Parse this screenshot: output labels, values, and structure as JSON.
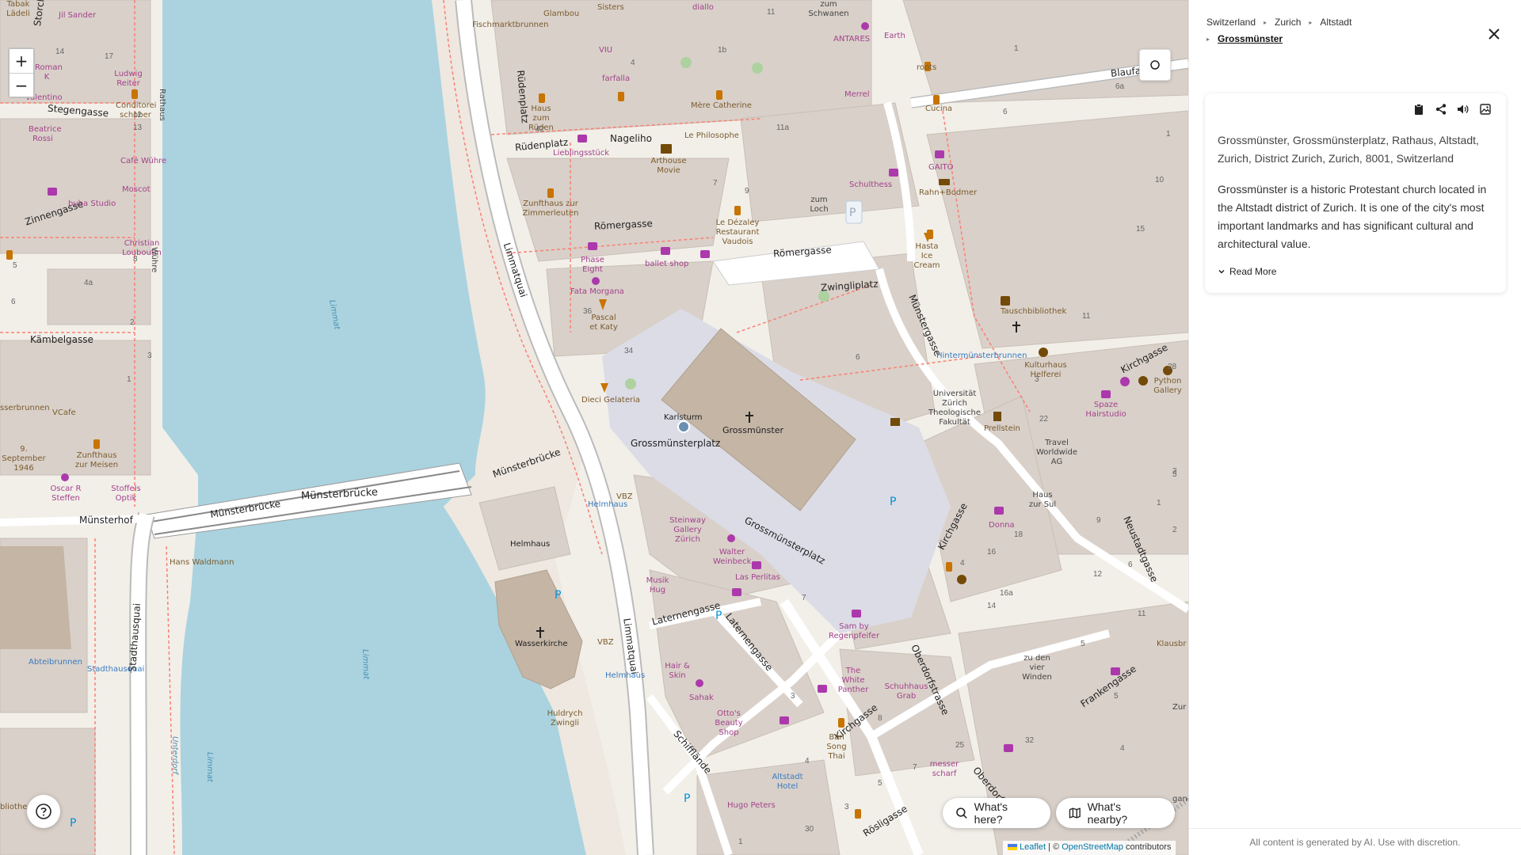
{
  "map": {
    "zoom_in": "+",
    "zoom_out": "−",
    "streets": [
      {
        "id": "ruedenplatz-1",
        "text": "Rüdenplatz"
      },
      {
        "id": "ruedenplatz-2",
        "text": "Rüdenplatz"
      },
      {
        "id": "nageliho",
        "text": "Nageliho"
      },
      {
        "id": "roemergasse-1",
        "text": "Römergasse"
      },
      {
        "id": "roemergasse-2",
        "text": "Römergasse"
      },
      {
        "id": "zwingliplatz",
        "text": "Zwingliplatz"
      },
      {
        "id": "limmatquai-1",
        "text": "Limmatquai"
      },
      {
        "id": "limmatquai-2",
        "text": "Limmatquai"
      },
      {
        "id": "muensterbruecke-1",
        "text": "Münsterbrücke"
      },
      {
        "id": "muensterbruecke-2",
        "text": "Münsterbrücke"
      },
      {
        "id": "muensterbruecke-3",
        "text": "Münsterbrücke"
      },
      {
        "id": "muensterhof",
        "text": "Münsterhof"
      },
      {
        "id": "grossmuensterplatz-1",
        "text": "Grossmünsterplatz"
      },
      {
        "id": "grossmuensterplatz-2",
        "text": "Grossmünsterplatz"
      },
      {
        "id": "stegengasse",
        "text": "Stegengasse"
      },
      {
        "id": "zinnengasse",
        "text": "Zinnengasse"
      },
      {
        "id": "kaembelgasse",
        "text": "Kämbelgasse"
      },
      {
        "id": "laternengasse-1",
        "text": "Laternengasse"
      },
      {
        "id": "laternengasse-2",
        "text": "Laternengasse"
      },
      {
        "id": "kirchgasse-1",
        "text": "Kirchgasse"
      },
      {
        "id": "kirchgasse-2",
        "text": "Kirchgasse"
      },
      {
        "id": "kirchgasse-3",
        "text": "Kirchgasse"
      },
      {
        "id": "muenstergasse",
        "text": "Münstergasse"
      },
      {
        "id": "neustadtgasse",
        "text": "Neustadtgasse"
      },
      {
        "id": "oberdorfstrasse-1",
        "text": "Oberdorfstrasse"
      },
      {
        "id": "oberdorfstrasse-2",
        "text": "Oberdorfstr"
      },
      {
        "id": "frankengasse",
        "text": "Frankengasse"
      },
      {
        "id": "roesligasse",
        "text": "Rösligasse"
      },
      {
        "id": "schifflaende",
        "text": "Schifflände"
      },
      {
        "id": "stadthausquai",
        "text": "Stadthausquai"
      },
      {
        "id": "blaufahne",
        "text": "Blaufa"
      },
      {
        "id": "storchengasse",
        "text": "Storche"
      }
    ],
    "pois": [
      {
        "id": "grossmuenster",
        "text": "Grossmünster"
      },
      {
        "id": "wasserkirche",
        "text": "Wasserkirche"
      },
      {
        "id": "helmhaus",
        "text": "Helmhaus"
      },
      {
        "id": "karlsturm",
        "text": "Karlsturm"
      },
      {
        "id": "huldrych-zwingli",
        "text": "Huldrych Zwingli"
      },
      {
        "id": "hans-waldmann",
        "text": "Hans Waldmann"
      },
      {
        "id": "arthouse-movie",
        "text": "Arthouse Movie"
      },
      {
        "id": "schulthess",
        "text": "Schulthess"
      },
      {
        "id": "zum-loch",
        "text": "zum Loch"
      },
      {
        "id": "universitaet",
        "text": "Universität Zürich Theologische Fakultät"
      },
      {
        "id": "tauschbibliothek",
        "text": "Tauschbibliothek"
      },
      {
        "id": "kulturhaus-helferei",
        "text": "Kulturhaus Helferei"
      },
      {
        "id": "hintermuensterbrunnen",
        "text": "Hintermünsterbrunnen"
      },
      {
        "id": "python-gallery",
        "text": "Python Gallery"
      },
      {
        "id": "spaze-hairstudio",
        "text": "Spaze Hairstudio"
      },
      {
        "id": "travel-worldwide",
        "text": "Travel Worldwide AG"
      },
      {
        "id": "haus-zur-sul",
        "text": "Haus zur Sul"
      },
      {
        "id": "prellstein",
        "text": "Prellstein"
      },
      {
        "id": "donna",
        "text": "Donna"
      },
      {
        "id": "steinway",
        "text": "Steinway Gallery Zürich"
      },
      {
        "id": "walter-weinbeck",
        "text": "Walter Weinbeck"
      },
      {
        "id": "las-perlitas",
        "text": "Las Perlitas"
      },
      {
        "id": "musik-hug",
        "text": "Musik Hug"
      },
      {
        "id": "sam-by-regenpfeifer",
        "text": "Sam by Regenpfeifer"
      },
      {
        "id": "white-panther",
        "text": "The White Panther"
      },
      {
        "id": "schuhhaus-grab",
        "text": "Schuhhaus Grab"
      },
      {
        "id": "zu-den-vier-winden",
        "text": "zu den vier Winden"
      },
      {
        "id": "hair-skin",
        "text": "Hair & Skin"
      },
      {
        "id": "sahak",
        "text": "Sahak"
      },
      {
        "id": "ottos-beauty",
        "text": "Otto's Beauty Shop"
      },
      {
        "id": "ban-song-thai",
        "text": "Ban Song Thai"
      },
      {
        "id": "altstadt-hotel",
        "text": "Altstadt Hotel"
      },
      {
        "id": "hugo-peters",
        "text": "Hugo Peters"
      },
      {
        "id": "messer-scharf",
        "text": "messer scharf"
      },
      {
        "id": "dieci-gelateria",
        "text": "Dieci Gelateria"
      },
      {
        "id": "pascal-katy",
        "text": "Pascal et Katy"
      },
      {
        "id": "fata-morgana",
        "text": "Fata Morgana"
      },
      {
        "id": "phase-eight",
        "text": "Phase Eight"
      },
      {
        "id": "ballet-shop",
        "text": "ballet shop"
      },
      {
        "id": "le-dezaley",
        "text": "Le Dézaley Restaurant Vaudois"
      },
      {
        "id": "zunfthaus-zimmerleuten",
        "text": "Zunfthaus zur Zimmerleuten"
      },
      {
        "id": "lieblingsstueck",
        "text": "Lieblingsstück"
      },
      {
        "id": "haus-zum-rueden",
        "text": "Haus zum Rüden"
      },
      {
        "id": "mere-catherine",
        "text": "Mère Catherine"
      },
      {
        "id": "le-philosophe",
        "text": "Le Philosophe"
      },
      {
        "id": "farfalla",
        "text": "farfalla"
      },
      {
        "id": "viu",
        "text": "VIU"
      },
      {
        "id": "fischmarktbrunnen",
        "text": "Fischmarktbrunnen"
      },
      {
        "id": "glambou",
        "text": "Glambou"
      },
      {
        "id": "sisters",
        "text": "Sisters"
      },
      {
        "id": "diallo",
        "text": "diallo"
      },
      {
        "id": "zum-schwanen",
        "text": "zum Schwanen"
      },
      {
        "id": "antares",
        "text": "ANTARES"
      },
      {
        "id": "earth",
        "text": "Earth"
      },
      {
        "id": "roots",
        "text": "roots"
      },
      {
        "id": "merrel",
        "text": "Merrel"
      },
      {
        "id": "cucina",
        "text": "Cucina"
      },
      {
        "id": "gaito",
        "text": "GAITO"
      },
      {
        "id": "rahn-bodmer",
        "text": "Rahn+Bodmer"
      },
      {
        "id": "hasta-ice-cream",
        "text": "Hasta Ice Cream"
      },
      {
        "id": "vbz-1",
        "text": "VBZ"
      },
      {
        "id": "vbz-2",
        "text": "VBZ"
      },
      {
        "id": "helmhaus-stop-1",
        "text": "Helmhaus"
      },
      {
        "id": "helmhaus-stop-2",
        "text": "Helmhaus"
      },
      {
        "id": "stadthausquai-stop",
        "text": "Stadthausquai"
      },
      {
        "id": "abteibrunnen",
        "text": "Abteibrunnen"
      },
      {
        "id": "zunfthaus-meisen",
        "text": "Zunfthaus zur Meisen"
      },
      {
        "id": "oscar-r-steffen",
        "text": "Oscar R Steffen"
      },
      {
        "id": "stoffels-optik",
        "text": "Stoffels Optik"
      },
      {
        "id": "9-september",
        "text": "9. September 1946"
      },
      {
        "id": "ssenbrunnen",
        "text": "sserbrunnen"
      },
      {
        "id": "vcafe",
        "text": "VCafe"
      },
      {
        "id": "buba-studio",
        "text": "buba Studio"
      },
      {
        "id": "christian-louboutin",
        "text": "Christian Louboutin"
      },
      {
        "id": "cafe-wuhre",
        "text": "Café Wühre"
      },
      {
        "id": "moscot",
        "text": "Moscot"
      },
      {
        "id": "beatrice-rossi",
        "text": "Beatrice Rossi"
      },
      {
        "id": "valentino",
        "text": "Valentino"
      },
      {
        "id": "conditorei-schober",
        "text": "Conditorei schober"
      },
      {
        "id": "ludwig-reiter",
        "text": "Ludwig Reiter"
      },
      {
        "id": "roman-k",
        "text": "Roman K"
      },
      {
        "id": "jil-sander",
        "text": "Jil Sander"
      },
      {
        "id": "tabak-laedeli",
        "text": "Tabak Lädeli"
      },
      {
        "id": "klausbr",
        "text": "Klausbr"
      },
      {
        "id": "zur",
        "text": "Zur"
      },
      {
        "id": "bliothe",
        "text": "bliothe"
      },
      {
        "id": "wuhre",
        "text": "Wühre"
      },
      {
        "id": "rathaus-label",
        "text": "Rathaus"
      },
      {
        "id": "limmat-1",
        "text": "Limmat"
      },
      {
        "id": "limmat-2",
        "text": "Limmat"
      },
      {
        "id": "limmat-3",
        "text": "Limmat"
      },
      {
        "id": "unterdorf",
        "text": "Unterdorf"
      },
      {
        "id": "gande",
        "text": "gande"
      }
    ],
    "house_numbers": [
      "14",
      "17",
      "12",
      "13",
      "8",
      "4a",
      "2",
      "6",
      "3",
      "5",
      "1",
      "42",
      "11",
      "4",
      "9",
      "1b",
      "11a",
      "7",
      "36",
      "34",
      "6",
      "28",
      "11",
      "22",
      "1",
      "3",
      "5",
      "9",
      "18",
      "16",
      "16a",
      "14",
      "12",
      "5",
      "6",
      "7",
      "4",
      "3",
      "8",
      "25",
      "32",
      "4",
      "5",
      "7",
      "3",
      "30",
      "1",
      "2",
      "4",
      "3",
      "10",
      "15",
      "6a",
      "6",
      "1",
      "3",
      "5",
      "2",
      "11",
      "6",
      "1"
    ],
    "help_icon": "question-icon",
    "whats_here": "What's here?",
    "whats_nearby": "What's nearby?",
    "attribution_leaflet": "Leaflet",
    "attribution_sep": " | © ",
    "attribution_osm": "OpenStreetMap",
    "attribution_contrib": " contributors"
  },
  "panel": {
    "breadcrumb": [
      "Switzerland",
      "Zurich",
      "Altstadt",
      "Grossmünster"
    ],
    "address": "Grossmünster, Grossmünsterplatz, Rathaus, Altstadt, Zurich, District Zurich, Zurich, 8001, Switzerland",
    "description": "Grossmünster is a historic Protestant church located in the Altstadt district of Zurich. It is one of the city's most important landmarks and has significant cultural and architectural value.",
    "read_more": "Read More",
    "footer": "All content is generated by AI. Use with discretion.",
    "tools": [
      "clipboard-icon",
      "share-icon",
      "speaker-icon",
      "image-icon"
    ]
  },
  "colors": {
    "water": "#aad3df",
    "building": "#d9d0c9",
    "church": "#c4b5a5",
    "plaza": "#dcdce6",
    "road": "#ffffff",
    "footway": "#fa8072",
    "poi_pink": "#a2438b",
    "poi_orange": "#c77400"
  }
}
